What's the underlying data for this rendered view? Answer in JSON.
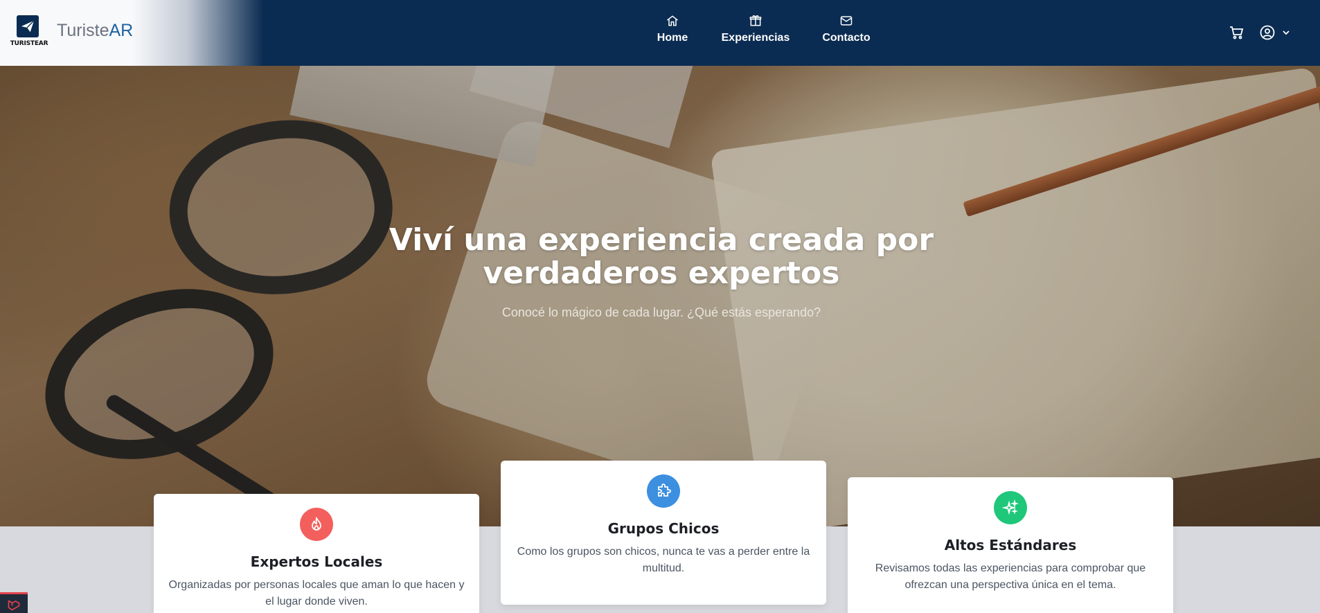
{
  "brand": {
    "logo_text": "TURISTEAR",
    "name_part1": "Turiste",
    "name_part2": "AR"
  },
  "nav": {
    "items": [
      {
        "label": "Home",
        "icon": "home-icon"
      },
      {
        "label": "Experiencias",
        "icon": "gift-icon"
      },
      {
        "label": "Contacto",
        "icon": "mail-icon"
      }
    ],
    "cart_icon": "cart-icon",
    "user_icon": "user-circle-icon"
  },
  "hero": {
    "title": "Viví una experiencia creada por verdaderos expertos",
    "subtitle": "Conocé lo mágico de cada lugar. ¿Qué estás esperando?"
  },
  "features": [
    {
      "title": "Expertos Locales",
      "text": "Organizadas por personas locales que aman lo que hacen y el lugar donde viven.",
      "icon": "fire-icon",
      "color": "#f25f5c"
    },
    {
      "title": "Grupos Chicos",
      "text": "Como los grupos son chicos, nunca te vas a perder entre la multitud.",
      "icon": "puzzle-icon",
      "color": "#3d8fe0"
    },
    {
      "title": "Altos Estándares",
      "text": "Revisamos todas las experiencias para comprobar que ofrezcan una perspectiva única en el tema.",
      "icon": "sparkles-icon",
      "color": "#1fc77a"
    }
  ],
  "colors": {
    "navbar": "#0b2c52",
    "page_bg": "#d7d9de",
    "brand_accent": "#1e63a3"
  }
}
